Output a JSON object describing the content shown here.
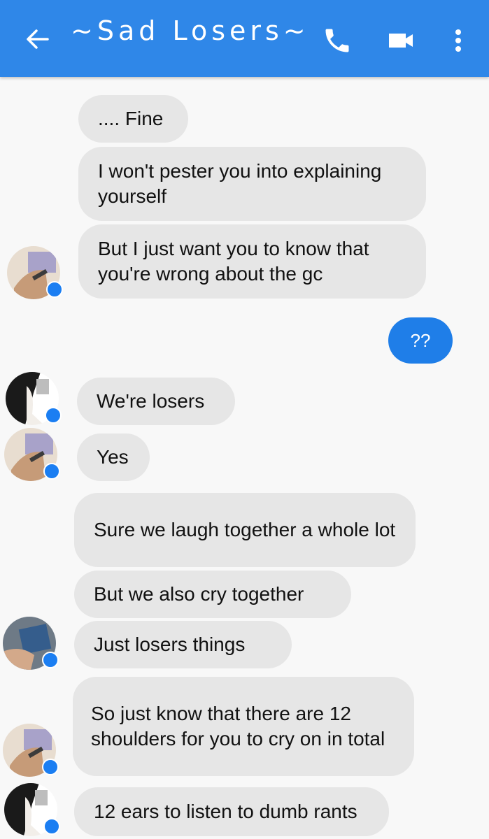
{
  "header": {
    "title": "~Sad Losers~",
    "back_icon": "arrow-left-icon",
    "call_icon": "phone-icon",
    "video_icon": "video-camera-icon",
    "menu_icon": "more-vertical-icon",
    "bar_color": "#2f87e8"
  },
  "messages": [
    {
      "sender": "other",
      "text": ".... Fine"
    },
    {
      "sender": "other",
      "text": "I won't pester you into explaining yourself"
    },
    {
      "sender": "other",
      "text": "But I just want you to know that you're wrong about the gc"
    },
    {
      "sender": "me",
      "text": "??"
    },
    {
      "sender": "other",
      "text": "We're losers"
    },
    {
      "sender": "other",
      "text": "Yes"
    },
    {
      "sender": "other",
      "text": "Sure we laugh together a whole lot"
    },
    {
      "sender": "other",
      "text": "But we also cry together"
    },
    {
      "sender": "other",
      "text": "Just losers things"
    },
    {
      "sender": "other",
      "text": "So just know that there are 12 shoulders for you to cry on in total"
    },
    {
      "sender": "other",
      "text": "12 ears to listen to dumb rants"
    }
  ],
  "colors": {
    "incoming_bubble": "#e6e6e6",
    "outgoing_bubble": "#1f7ee8",
    "messenger_badge": "#1b7ef2"
  }
}
